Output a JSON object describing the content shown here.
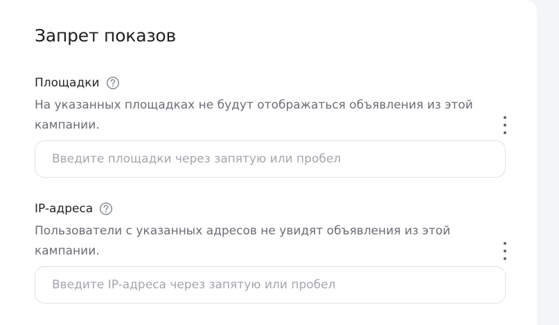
{
  "page": {
    "title": "Запрет показов"
  },
  "sections": [
    {
      "label": "Площадки",
      "description": "На указанных площадках не будут отображаться объявления из этой кампании.",
      "input_placeholder": "Введите площадки через запятую или пробел",
      "input_value": "",
      "help_icon": "question-circle-icon",
      "more_icon": "more-vertical-icon"
    },
    {
      "label": "IP-адреса",
      "description": "Пользователи с указанных адресов не увидят объявления из этой кампании.",
      "input_placeholder": "Введите IP-адреса через запятую или пробел",
      "input_value": "",
      "help_icon": "question-circle-icon",
      "more_icon": "more-vertical-icon"
    }
  ],
  "colors": {
    "background": "#f4f5f7",
    "card": "#ffffff",
    "text": "#222222",
    "muted_text": "#6a6d74",
    "placeholder": "#a3a6ad",
    "border": "#e0e2e6"
  }
}
